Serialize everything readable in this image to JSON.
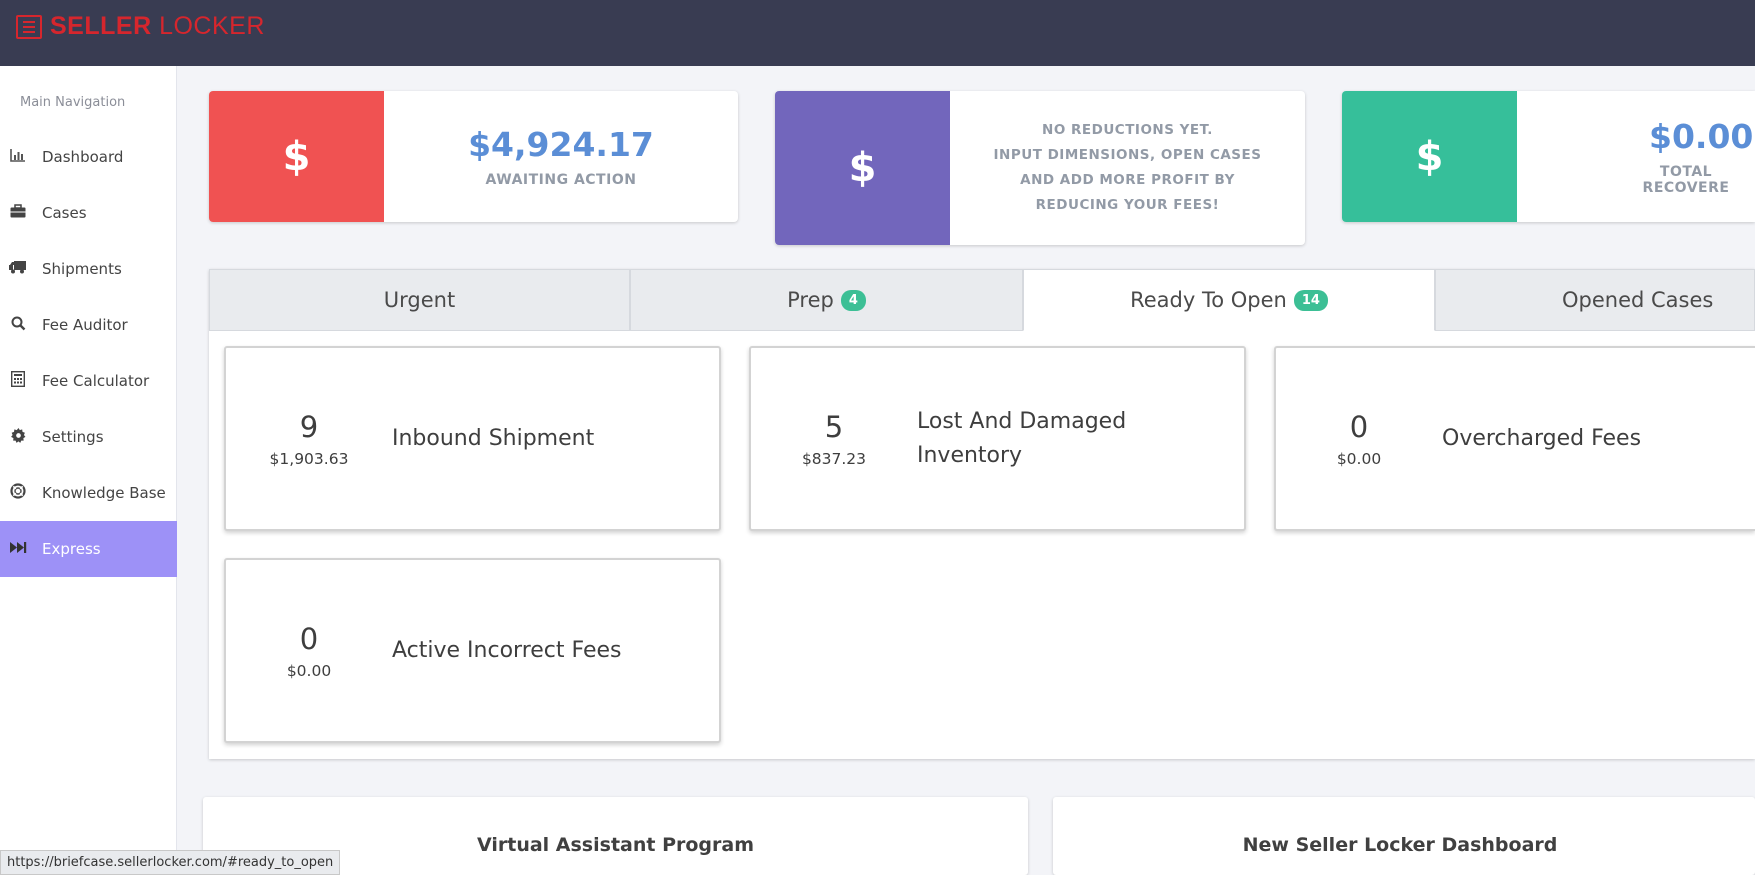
{
  "header": {
    "logo_bold": "SELLER",
    "logo_light": " LOCKER",
    "bg_color": "#393c52",
    "brand_color": "#d6262d"
  },
  "sidebar": {
    "title": "Main Navigation",
    "items": [
      {
        "label": "Dashboard",
        "icon": "bar-chart-icon"
      },
      {
        "label": "Cases",
        "icon": "briefcase-icon"
      },
      {
        "label": "Shipments",
        "icon": "truck-icon"
      },
      {
        "label": "Fee Auditor",
        "icon": "search-icon"
      },
      {
        "label": "Fee Calculator",
        "icon": "calculator-icon"
      },
      {
        "label": "Settings",
        "icon": "gear-icon"
      },
      {
        "label": "Knowledge Base",
        "icon": "life-ring-icon"
      },
      {
        "label": "Express",
        "icon": "fast-forward-icon",
        "active": true
      }
    ],
    "active_color": "#9d91f7"
  },
  "stats": [
    {
      "icon": "dollar-icon",
      "symbol": "$",
      "amount": "$4,924.17",
      "caption": "AWAITING ACTION",
      "color": "#f05252"
    },
    {
      "icon": "dollar-icon",
      "symbol": "$",
      "note_lines": [
        "NO REDUCTIONS YET.",
        "INPUT DIMENSIONS, OPEN CASES",
        "AND ADD MORE PROFIT BY",
        "REDUCING YOUR FEES!"
      ],
      "color": "#7266bc"
    },
    {
      "icon": "dollar-icon",
      "symbol": "$",
      "amount": "$0.00",
      "caption": "TOTAL RECOVERE",
      "color": "#36bf9a"
    }
  ],
  "tabs": [
    {
      "label": "Urgent"
    },
    {
      "label": "Prep",
      "badge": "4"
    },
    {
      "label": "Ready To Open",
      "badge": "14",
      "active": true
    },
    {
      "label": "Opened Cases"
    }
  ],
  "cards": [
    {
      "count": "9",
      "sum": "$1,903.63",
      "label_lines": [
        "Inbound Shipment"
      ]
    },
    {
      "count": "5",
      "sum": "$837.23",
      "label_lines": [
        "Lost And Damaged",
        "Inventory"
      ]
    },
    {
      "count": "0",
      "sum": "$0.00",
      "label_lines": [
        "Overcharged Fees"
      ]
    },
    {
      "count": "0",
      "sum": "$0.00",
      "label_lines": [
        "Active Incorrect Fees"
      ]
    }
  ],
  "promos": [
    {
      "title": "Virtual Assistant Program"
    },
    {
      "title": "New Seller Locker Dashboard"
    }
  ],
  "status_url": "https://briefcase.sellerlocker.com/#ready_to_open",
  "badge_color": "#3cbf95"
}
